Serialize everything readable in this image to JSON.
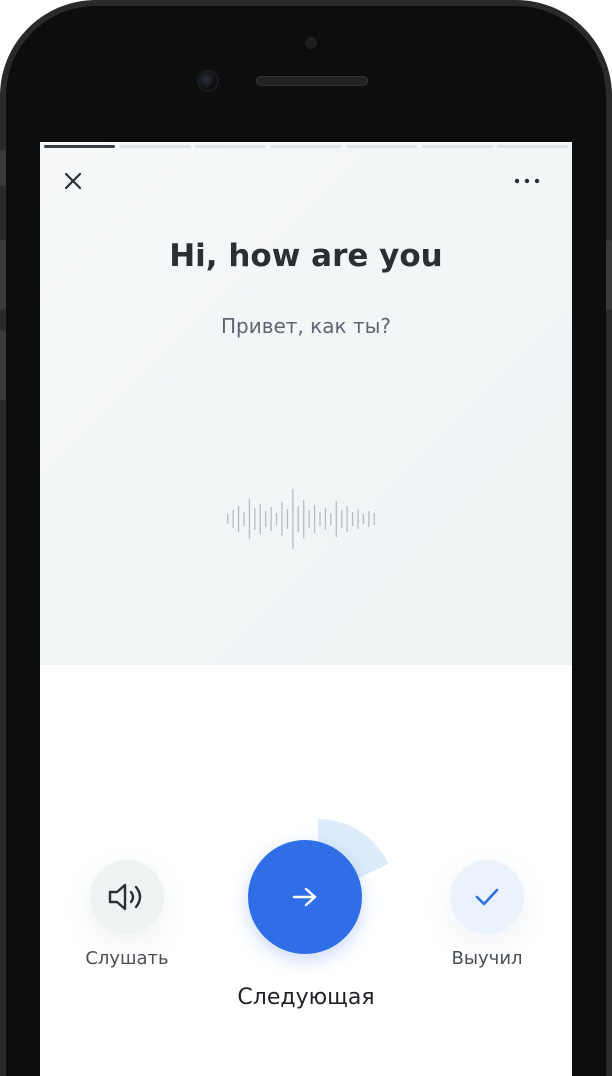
{
  "card": {
    "phrase": "Hi, how are you",
    "translation": "Привет, как ты?",
    "progress": {
      "total_segments": 7,
      "current_segment": 1
    }
  },
  "header": {
    "close_icon": "close-icon",
    "more_icon": "more-horizontal-icon"
  },
  "actions": {
    "listen": {
      "label": "Слушать",
      "icon": "speaker-icon"
    },
    "next": {
      "label": "Следующая",
      "icon": "arrow-right-icon",
      "timer_fraction": 0.18
    },
    "learned": {
      "label": "Выучил",
      "icon": "checkmark-icon"
    }
  },
  "colors": {
    "accent": "#2f6ee6",
    "accent_light": "#dcecfb",
    "text_primary": "#2b2e33",
    "text_secondary": "#5f6470"
  }
}
